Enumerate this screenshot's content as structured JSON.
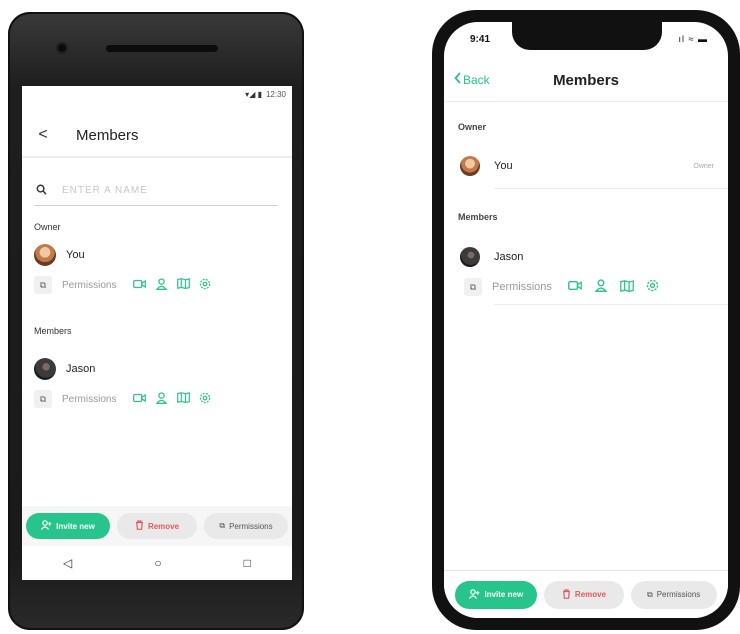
{
  "android": {
    "status_time": "12:30",
    "status_icons": "▾◢ ▮",
    "back_icon": "<",
    "title": "Members",
    "search_placeholder": "ENTER A NAME",
    "owner_section": "Owner",
    "owner_name": "You",
    "permissions_label": "Permissions",
    "members_section": "Members",
    "member_name": "Jason",
    "buttons": {
      "invite": "Invite new",
      "remove": "Remove",
      "permissions": "Permissions"
    },
    "nav": {
      "back": "◁",
      "home": "○",
      "recents": "□"
    }
  },
  "iphone": {
    "status_time": "9:41",
    "status_icons": "ıl ≈ ▬",
    "back_label": "Back",
    "title": "Members",
    "owner_section": "Owner",
    "owner_name": "You",
    "owner_role": "Owner",
    "members_section": "Members",
    "member_name": "Jason",
    "permissions_label": "Permissions",
    "buttons": {
      "invite": "Invite new",
      "remove": "Remove",
      "permissions": "Permissions"
    }
  },
  "icons": {
    "permission_box": "⧉",
    "video": "video-icon",
    "person": "person-icon",
    "map": "map-icon",
    "settings": "gear-icon",
    "add_person": "add-person-icon",
    "trash": "trash-icon"
  },
  "colors": {
    "accent": "#27c48b",
    "danger": "#e05a5a"
  }
}
